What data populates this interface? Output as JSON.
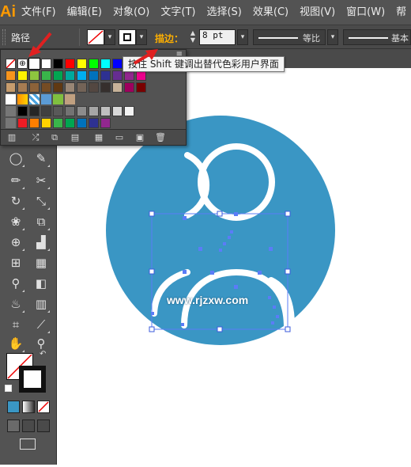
{
  "app": {
    "logo": "Ai"
  },
  "menu": {
    "items": [
      {
        "label": "文件(F)"
      },
      {
        "label": "编辑(E)"
      },
      {
        "label": "对象(O)"
      },
      {
        "label": "文字(T)"
      },
      {
        "label": "选择(S)"
      },
      {
        "label": "效果(C)"
      },
      {
        "label": "视图(V)"
      },
      {
        "label": "窗口(W)"
      },
      {
        "label": "帮"
      }
    ]
  },
  "control_bar": {
    "object_label": "路径",
    "stroke_label": "描边：",
    "stroke_value": "8 pt",
    "profile_uniform": "等比",
    "brush_basic": "基本"
  },
  "swatch_panel": {
    "tooltip": "按住 Shift 键调出替代色彩用户界面",
    "colors": {
      "row1": [
        "#ffffff",
        "#000000",
        "#ff0000",
        "#ffff00",
        "#00ff00",
        "#00ffff",
        "#0000ff",
        "#ff00ff",
        "#ed1c24",
        "#f26522"
      ],
      "row2": [
        "#f7941d",
        "#fff200",
        "#8dc63f",
        "#39b54a",
        "#00a651",
        "#00a99d",
        "#00aeef",
        "#0072bc",
        "#2e3192",
        "#662d91",
        "#92278f",
        "#ec008c"
      ],
      "row3": [
        "#c69c6d",
        "#a67c52",
        "#8c6239",
        "#754c24",
        "#603913",
        "#998675",
        "#736357",
        "#534741",
        "#362f2d",
        "#c7b299",
        "#9e005d",
        "#790000"
      ],
      "row5": [
        "#000000",
        "#262626",
        "#404040",
        "#595959",
        "#737373",
        "#8c8c8c",
        "#a6a6a6",
        "#bfbfbf",
        "#d9d9d9",
        "#f2f2f2"
      ],
      "row6": [
        "#ed1c24",
        "#ff7f00",
        "#ffd200",
        "#39b54a",
        "#00a651",
        "#0072bc",
        "#2e3192",
        "#92278f"
      ]
    }
  },
  "tools": {
    "icons": [
      "selection-icon",
      "direct-selection-icon",
      "ellipse-icon",
      "brush-icon",
      "pencil-icon",
      "scissors-icon",
      "rotate-icon",
      "scale-icon",
      "warp-icon",
      "free-transform-icon",
      "shape-builder-icon",
      "graph-icon",
      "mesh-icon",
      "gradient-icon",
      "eyedropper-icon",
      "blend-icon",
      "symbol-sprayer-icon",
      "column-graph-icon",
      "artboard-icon",
      "slice-icon",
      "hand-icon",
      "zoom-icon"
    ]
  },
  "canvas": {
    "circle_color": "#3a96c4",
    "watermark": "www.rjzxw.com"
  }
}
